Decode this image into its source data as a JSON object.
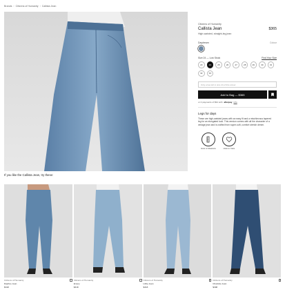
{
  "breadcrumb": [
    "Brands",
    "Citizens of Humanity",
    "Callista Jean"
  ],
  "product": {
    "brand": "Citizens of Humanity",
    "name": "Callista Jean",
    "price": "$365",
    "subtitle": "High-waisted, straight-leg jean",
    "color_label": "Daydream",
    "color_note": "Colour",
    "color_swatch": "#6f8aa6",
    "size_label": "Size 24 — Low Stock",
    "size_chart_label": "Find Your Size",
    "sizes": [
      "23",
      "24",
      "25",
      "26",
      "27",
      "28",
      "29",
      "30",
      "31",
      "32",
      "33"
    ],
    "selected_size": "24",
    "find_placeholder": "Only a few left in size 24 of this colour",
    "add_to_bag": "Add to Bag — $365",
    "afterpay_prefix": "or 4 payments of $91 with",
    "afterpay_brand": "afterpay",
    "afterpay_info": "Info",
    "description_title": "Legs for days",
    "description": "These are high-waisted jeans with an easy fit and a mischievous tapered leg for an elongated look. This version comes with all the character of a vintage jean and is crafted from super-soft, comfort stretch denim.",
    "features": [
      {
        "label": "How to Measure",
        "icon": "ruler-icon"
      },
      {
        "label": "How to Care",
        "icon": "care-icon"
      }
    ]
  },
  "recommendations": {
    "heading": "If you like the Callista Jean, try these:",
    "items": [
      {
        "brand": "Citizens of Humanity",
        "name": "Daphne Jean",
        "price": "$318"
      },
      {
        "brand": "Citizens of Humanity",
        "name": "Emery",
        "price": "$318"
      },
      {
        "brand": "Citizens of Humanity",
        "name": "Libby Jean",
        "price": "$318"
      },
      {
        "brand": "Citizens of Humanity",
        "name": "Charlotte Jean",
        "price": "$398"
      }
    ]
  },
  "colors": {
    "accent": "#111111",
    "denim_light": "#8fb0cc",
    "denim_mid": "#5f86ab",
    "denim_dark": "#2f4e73"
  }
}
